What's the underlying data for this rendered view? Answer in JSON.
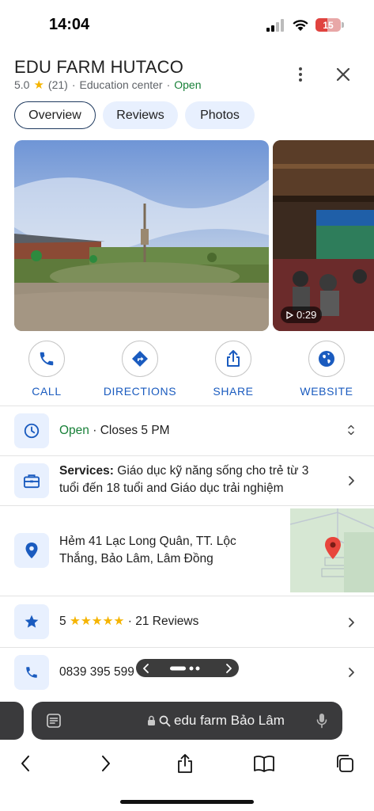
{
  "status": {
    "time": "14:04",
    "battery": "15"
  },
  "place": {
    "title": "EDU FARM HUTACO",
    "rating": "5.0",
    "review_count": "(21)",
    "category": "Education center",
    "open_status": "Open"
  },
  "tabs": [
    {
      "label": "Overview",
      "active": true
    },
    {
      "label": "Reviews",
      "active": false
    },
    {
      "label": "Photos",
      "active": false
    }
  ],
  "photos": {
    "video_duration": "0:29"
  },
  "actions": [
    {
      "label": "CALL",
      "icon": "phone-icon"
    },
    {
      "label": "DIRECTIONS",
      "icon": "directions-icon"
    },
    {
      "label": "SHARE",
      "icon": "share-icon"
    },
    {
      "label": "WEBSITE",
      "icon": "globe-icon"
    }
  ],
  "hours": {
    "status": "Open",
    "separator": "·",
    "closes": "Closes 5 PM"
  },
  "services": {
    "label": "Services:",
    "line1": "Giáo dục kỹ năng sống cho trẻ từ 3",
    "line2": "tuổi đến 18 tuổi and Giáo dục trải nghiệm"
  },
  "address": {
    "line1": "Hẻm 41 Lạc Long Quân, TT. Lộc",
    "line2": "Thắng, Bảo Lâm, Lâm Đồng"
  },
  "rating_row": {
    "score": "5",
    "stars": "★★★★★",
    "separator": "·",
    "reviews": "21 Reviews"
  },
  "phone": {
    "number": "0839 395 599"
  },
  "browser": {
    "address_text": "edu farm Bảo Lâm"
  },
  "colors": {
    "accent": "#1a5bbf",
    "open_green": "#188038",
    "star_yellow": "#f5b400",
    "chip_bg": "#e8f0fe",
    "map_pin": "#e8453c"
  }
}
